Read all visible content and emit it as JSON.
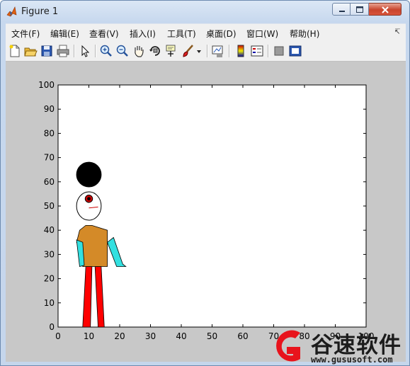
{
  "window": {
    "title": "Figure 1"
  },
  "menu": [
    "文件(F)",
    "编辑(E)",
    "查看(V)",
    "插入(I)",
    "工具(T)",
    "桌面(D)",
    "窗口(W)",
    "帮助(H)"
  ],
  "toolbar": [
    "new-figure",
    "open-file",
    "save",
    "print",
    "edit-plot",
    "zoom-in",
    "zoom-out",
    "pan",
    "rotate-3d",
    "data-cursor",
    "brush",
    "link-plot",
    "colorbar",
    "legend",
    "hide-plot-tools",
    "show-plot-tools"
  ],
  "axes": {
    "xlim": [
      0,
      100
    ],
    "ylim": [
      0,
      100
    ],
    "xticks": [
      "0",
      "10",
      "20",
      "30",
      "40",
      "50",
      "60",
      "70",
      "80",
      "90",
      "100"
    ],
    "yticks": [
      "0",
      "10",
      "20",
      "30",
      "40",
      "50",
      "60",
      "70",
      "80",
      "90",
      "100"
    ],
    "grid": false
  },
  "scene": {
    "hat": {
      "cx": 10,
      "cy": 63,
      "r": 4,
      "color": "#000000"
    },
    "head": {
      "cx": 10,
      "cy": 50,
      "r": 4,
      "color": "#ffffff"
    },
    "eye": {
      "cx": 10,
      "cy": 53,
      "r": 1.2,
      "color": "#cc0000",
      "pupil_color": "#000000"
    },
    "mouth": {
      "points": [
        [
          10,
          49.2
        ],
        [
          13,
          49.6
        ]
      ],
      "color": "#cc0000"
    },
    "torso": {
      "points": [
        [
          9,
          42
        ],
        [
          11,
          42
        ],
        [
          16,
          40
        ],
        [
          16,
          25
        ],
        [
          8,
          25
        ],
        [
          8,
          33
        ],
        [
          6,
          35
        ],
        [
          7,
          40
        ]
      ],
      "color": "#d48a28"
    },
    "left_arm": {
      "points": [
        [
          6,
          36
        ],
        [
          8,
          35
        ],
        [
          8.5,
          25.5
        ],
        [
          7,
          25
        ]
      ],
      "color": "#33e0e0"
    },
    "right_arm": {
      "points": [
        [
          16,
          35
        ],
        [
          18,
          37
        ],
        [
          21,
          26
        ],
        [
          22,
          25
        ],
        [
          19,
          25
        ]
      ],
      "color": "#33e0e0"
    },
    "left_leg": {
      "points": [
        [
          9,
          25
        ],
        [
          11,
          25
        ],
        [
          10.5,
          0
        ],
        [
          8,
          0
        ]
      ],
      "color": "#ff0000"
    },
    "right_leg": {
      "points": [
        [
          12,
          25
        ],
        [
          14,
          25
        ],
        [
          15,
          0
        ],
        [
          13,
          0
        ]
      ],
      "color": "#ff0000"
    }
  },
  "watermark": {
    "brand": "谷速软件",
    "url": "www.gususoft.com",
    "color": "#e8131c"
  }
}
